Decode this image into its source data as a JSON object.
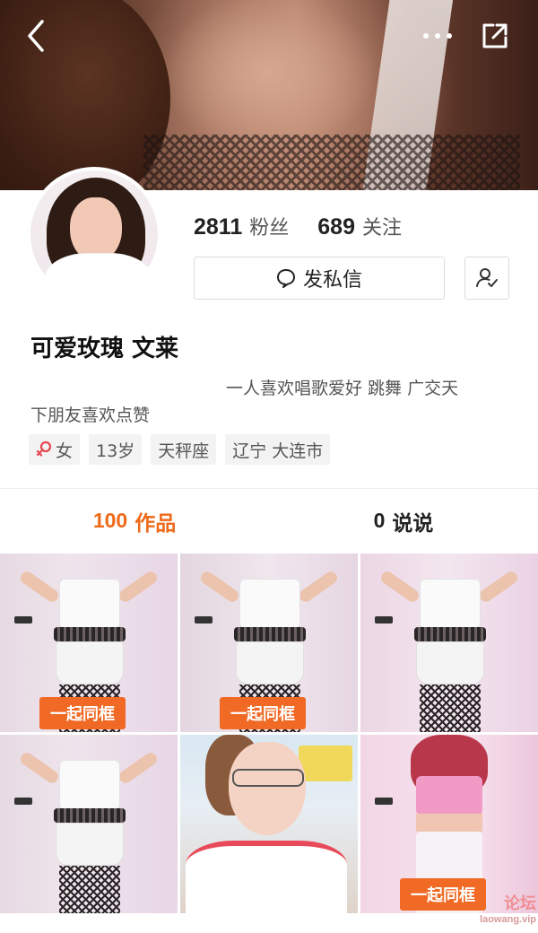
{
  "profile": {
    "followers_count": "2811",
    "followers_label": "粉丝",
    "following_count": "689",
    "following_label": "关注",
    "message_button": "发私信",
    "username": "可爱玫瑰 文莱",
    "bio_part1": "一人喜欢唱歌爱好 跳舞 广交天",
    "bio_part2": "下朋友喜欢点赞",
    "tags": {
      "gender": "女",
      "age": "13岁",
      "zodiac": "天秤座",
      "location": "辽宁 大连市"
    }
  },
  "tabs": {
    "works_count": "100",
    "works_label": "作品",
    "posts_count": "0",
    "posts_label": "说说"
  },
  "grid": {
    "badge_label": "一起同框",
    "items": [
      {
        "badge": "一起同框"
      },
      {
        "badge": "一起同框"
      },
      {
        "badge": ""
      },
      {
        "badge": ""
      },
      {
        "badge": ""
      },
      {
        "badge": "一起同框"
      }
    ]
  },
  "watermark": {
    "text": "论坛",
    "subtext": "laowang.vip"
  },
  "icons": {
    "back": "back-arrow-icon",
    "more": "more-dots-icon",
    "share": "share-icon",
    "message": "chat-bubble-icon",
    "follow": "add-user-icon",
    "gender": "female-icon"
  },
  "colors": {
    "accent": "#ee6a1a",
    "badge": "#f06a25",
    "gender_icon": "#e8474f"
  }
}
